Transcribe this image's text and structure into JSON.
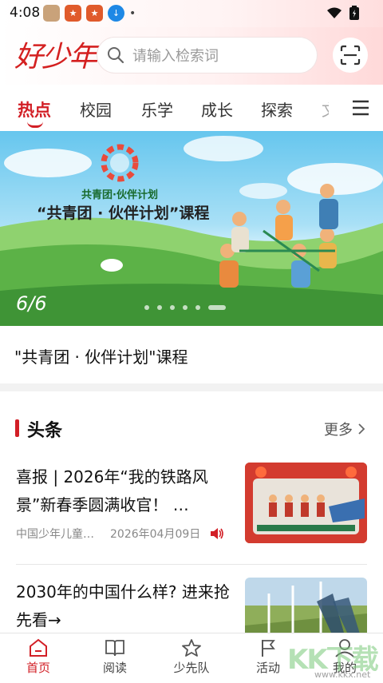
{
  "status_bar": {
    "time": "4:08",
    "apps": [
      "app-1",
      "app-2",
      "app-3",
      "download"
    ],
    "dot": "•"
  },
  "header": {
    "logo": "好少年",
    "search_placeholder": "请输入检索词"
  },
  "tabs": [
    {
      "label": "热点",
      "active": true
    },
    {
      "label": "校园",
      "active": false
    },
    {
      "label": "乐学",
      "active": false
    },
    {
      "label": "成长",
      "active": false
    },
    {
      "label": "探索",
      "active": false
    },
    {
      "label": "文",
      "active": false
    }
  ],
  "banner": {
    "subtitle": "共青团·伙伴计划",
    "title": "“共青团 · 伙伴计划”课程",
    "counter": "6/6",
    "dots": 6,
    "active_dot": 5
  },
  "banner_caption": "\"共青团 · 伙伴计划\"课程",
  "news_section": {
    "title": "头条",
    "more": "更多"
  },
  "news_items": [
    {
      "title": "喜报 | 2026年“我的铁路风景”新春季圆满收官！ …",
      "source": "中国少年儿童…",
      "date": "2026年04月09日"
    },
    {
      "title": "2030年的中国什么样? 进来抢先看→"
    }
  ],
  "bottom_nav": [
    {
      "label": "首页",
      "icon": "home-icon",
      "active": true
    },
    {
      "label": "阅读",
      "icon": "book-icon",
      "active": false
    },
    {
      "label": "少先队",
      "icon": "star-icon",
      "active": false
    },
    {
      "label": "活动",
      "icon": "flag-icon",
      "active": false
    },
    {
      "label": "我的",
      "icon": "user-icon",
      "active": false
    }
  ],
  "watermark": {
    "text": "KK下载",
    "url": "www.kkx.net"
  },
  "colors": {
    "accent": "#d21f26",
    "text": "#111111",
    "muted": "#888888"
  }
}
